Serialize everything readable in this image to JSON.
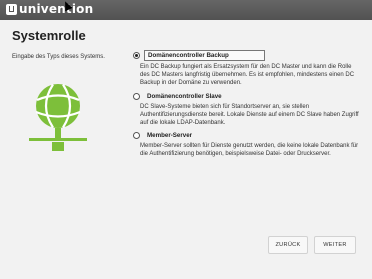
{
  "brand": {
    "name": "univention"
  },
  "page": {
    "title": "Systemrolle",
    "description": "Eingabe des Typs dieses Systems."
  },
  "illustration": {
    "icon": "globe-network-icon",
    "accent": "#7dbf3a"
  },
  "options": [
    {
      "label": "Domänencontroller Backup",
      "selected": true,
      "description": "Ein DC Backup fungiert als Ersatzsystem für den DC Master und kann die Rolle des DC Masters langfristig übernehmen. Es ist empfohlen, mindestens einen DC Backup in der Domäne zu verwenden."
    },
    {
      "label": "Domänencontroller Slave",
      "selected": false,
      "description": "DC Slave-Systeme bieten sich für Standortserver an, sie stellen Authentifizierungsdienste bereit. Lokale Dienste auf einem DC Slave haben Zugriff auf die lokale LDAP-Datenbank."
    },
    {
      "label": "Member-Server",
      "selected": false,
      "description": "Member-Server sollten für Dienste genutzt werden, die keine lokale Datenbank für die Authentifizierung benötigen, beispielsweise Datei- oder Druckserver."
    }
  ],
  "buttons": {
    "back": "ZURÜCK",
    "next": "WEITER"
  }
}
